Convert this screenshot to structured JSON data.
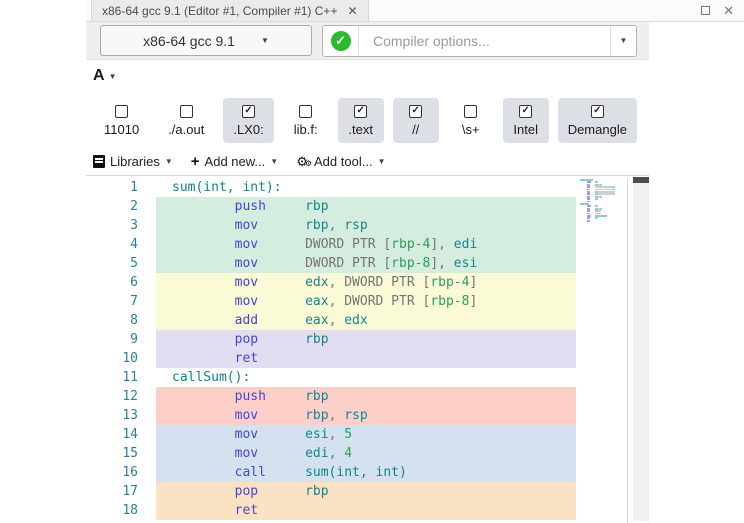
{
  "window": {
    "tab_title": "x86-64 gcc 9.1 (Editor #1, Compiler #1) C++",
    "tab_close": "✕",
    "close": "✕"
  },
  "toolbar": {
    "compiler_select_label": "x86-64 gcc 9.1",
    "status": "compile-success",
    "options_placeholder": "Compiler options...",
    "font_button_label": "A",
    "filters": [
      {
        "label": "11010",
        "checked": false
      },
      {
        "label": "./a.out",
        "checked": false
      },
      {
        "label": ".LX0:",
        "checked": true
      },
      {
        "label": "lib.f:",
        "checked": false
      },
      {
        "label": ".text",
        "checked": true
      },
      {
        "label": "//",
        "checked": true
      },
      {
        "label": "\\s+",
        "checked": false
      },
      {
        "label": "Intel",
        "checked": true
      },
      {
        "label": "Demangle",
        "checked": true
      }
    ],
    "actions": [
      {
        "icon": "book-icon",
        "label": "Libraries"
      },
      {
        "icon": "plus-icon",
        "label": "Add new..."
      },
      {
        "icon": "gears-icon",
        "label": "Add tool..."
      }
    ]
  },
  "editor": {
    "lines": [
      {
        "n": "1",
        "bg": "",
        "tokens": [
          {
            "t": "sum(int, int):",
            "c": "lab"
          }
        ]
      },
      {
        "n": "2",
        "bg": "green",
        "tokens": [
          {
            "t": "        ",
            "c": "pln"
          },
          {
            "t": "push",
            "c": "mne"
          },
          {
            "t": "     ",
            "c": "pln"
          },
          {
            "t": "rbp",
            "c": "reg"
          }
        ]
      },
      {
        "n": "3",
        "bg": "green",
        "tokens": [
          {
            "t": "        ",
            "c": "pln"
          },
          {
            "t": "mov",
            "c": "mne"
          },
          {
            "t": "      ",
            "c": "pln"
          },
          {
            "t": "rbp",
            "c": "reg"
          },
          {
            "t": ", ",
            "c": "pun"
          },
          {
            "t": "rsp",
            "c": "reg"
          }
        ]
      },
      {
        "n": "4",
        "bg": "green",
        "tokens": [
          {
            "t": "        ",
            "c": "pln"
          },
          {
            "t": "mov",
            "c": "mne"
          },
          {
            "t": "      ",
            "c": "pln"
          },
          {
            "t": "DWORD PTR [",
            "c": "pun"
          },
          {
            "t": "rbp",
            "c": "mem"
          },
          {
            "t": "-",
            "c": "pun"
          },
          {
            "t": "4",
            "c": "num"
          },
          {
            "t": "], ",
            "c": "pun"
          },
          {
            "t": "edi",
            "c": "reg"
          }
        ]
      },
      {
        "n": "5",
        "bg": "green",
        "tokens": [
          {
            "t": "        ",
            "c": "pln"
          },
          {
            "t": "mov",
            "c": "mne"
          },
          {
            "t": "      ",
            "c": "pln"
          },
          {
            "t": "DWORD PTR [",
            "c": "pun"
          },
          {
            "t": "rbp",
            "c": "mem"
          },
          {
            "t": "-",
            "c": "pun"
          },
          {
            "t": "8",
            "c": "num"
          },
          {
            "t": "], ",
            "c": "pun"
          },
          {
            "t": "esi",
            "c": "reg"
          }
        ]
      },
      {
        "n": "6",
        "bg": "yellow",
        "tokens": [
          {
            "t": "        ",
            "c": "pln"
          },
          {
            "t": "mov",
            "c": "mne"
          },
          {
            "t": "      ",
            "c": "pln"
          },
          {
            "t": "edx",
            "c": "reg"
          },
          {
            "t": ", ",
            "c": "pun"
          },
          {
            "t": "DWORD PTR [",
            "c": "pun"
          },
          {
            "t": "rbp",
            "c": "mem"
          },
          {
            "t": "-",
            "c": "pun"
          },
          {
            "t": "4",
            "c": "num"
          },
          {
            "t": "]",
            "c": "pun"
          }
        ]
      },
      {
        "n": "7",
        "bg": "yellow",
        "tokens": [
          {
            "t": "        ",
            "c": "pln"
          },
          {
            "t": "mov",
            "c": "mne"
          },
          {
            "t": "      ",
            "c": "pln"
          },
          {
            "t": "eax",
            "c": "reg"
          },
          {
            "t": ", ",
            "c": "pun"
          },
          {
            "t": "DWORD PTR [",
            "c": "pun"
          },
          {
            "t": "rbp",
            "c": "mem"
          },
          {
            "t": "-",
            "c": "pun"
          },
          {
            "t": "8",
            "c": "num"
          },
          {
            "t": "]",
            "c": "pun"
          }
        ]
      },
      {
        "n": "8",
        "bg": "yellow",
        "tokens": [
          {
            "t": "        ",
            "c": "pln"
          },
          {
            "t": "add",
            "c": "mne"
          },
          {
            "t": "      ",
            "c": "pln"
          },
          {
            "t": "eax",
            "c": "reg"
          },
          {
            "t": ", ",
            "c": "pun"
          },
          {
            "t": "edx",
            "c": "reg"
          }
        ]
      },
      {
        "n": "9",
        "bg": "purple",
        "tokens": [
          {
            "t": "        ",
            "c": "pln"
          },
          {
            "t": "pop",
            "c": "mne"
          },
          {
            "t": "      ",
            "c": "pln"
          },
          {
            "t": "rbp",
            "c": "reg"
          }
        ]
      },
      {
        "n": "10",
        "bg": "purple",
        "tokens": [
          {
            "t": "        ",
            "c": "pln"
          },
          {
            "t": "ret",
            "c": "mne"
          }
        ]
      },
      {
        "n": "11",
        "bg": "",
        "tokens": [
          {
            "t": "callSum():",
            "c": "lab"
          }
        ]
      },
      {
        "n": "12",
        "bg": "red",
        "tokens": [
          {
            "t": "        ",
            "c": "pln"
          },
          {
            "t": "push",
            "c": "mne"
          },
          {
            "t": "     ",
            "c": "pln"
          },
          {
            "t": "rbp",
            "c": "reg"
          }
        ]
      },
      {
        "n": "13",
        "bg": "red",
        "tokens": [
          {
            "t": "        ",
            "c": "pln"
          },
          {
            "t": "mov",
            "c": "mne"
          },
          {
            "t": "      ",
            "c": "pln"
          },
          {
            "t": "rbp",
            "c": "reg"
          },
          {
            "t": ", ",
            "c": "pun"
          },
          {
            "t": "rsp",
            "c": "reg"
          }
        ]
      },
      {
        "n": "14",
        "bg": "blue",
        "tokens": [
          {
            "t": "        ",
            "c": "pln"
          },
          {
            "t": "mov",
            "c": "mne"
          },
          {
            "t": "      ",
            "c": "pln"
          },
          {
            "t": "esi",
            "c": "reg"
          },
          {
            "t": ", ",
            "c": "pun"
          },
          {
            "t": "5",
            "c": "num"
          }
        ]
      },
      {
        "n": "15",
        "bg": "blue",
        "tokens": [
          {
            "t": "        ",
            "c": "pln"
          },
          {
            "t": "mov",
            "c": "mne"
          },
          {
            "t": "      ",
            "c": "pln"
          },
          {
            "t": "edi",
            "c": "reg"
          },
          {
            "t": ", ",
            "c": "pun"
          },
          {
            "t": "4",
            "c": "num"
          }
        ]
      },
      {
        "n": "16",
        "bg": "blue",
        "tokens": [
          {
            "t": "        ",
            "c": "pln"
          },
          {
            "t": "call",
            "c": "mne"
          },
          {
            "t": "     ",
            "c": "pln"
          },
          {
            "t": "sum(int, int)",
            "c": "lab"
          }
        ]
      },
      {
        "n": "17",
        "bg": "orange",
        "tokens": [
          {
            "t": "        ",
            "c": "pln"
          },
          {
            "t": "pop",
            "c": "mne"
          },
          {
            "t": "      ",
            "c": "pln"
          },
          {
            "t": "rbp",
            "c": "reg"
          }
        ]
      },
      {
        "n": "18",
        "bg": "orange",
        "tokens": [
          {
            "t": "        ",
            "c": "pln"
          },
          {
            "t": "ret",
            "c": "mne"
          }
        ]
      }
    ]
  },
  "colors": {
    "accent_green": "#2db92d",
    "line_green": "#d5eddf",
    "line_yellow": "#fafad6",
    "line_purple": "#e2ddf0",
    "line_red": "#fcd0c9",
    "line_blue": "#d3e2ee",
    "line_orange": "#fbe2c2",
    "tok_mnemonic": "#4444d6",
    "tok_register": "#16848c",
    "tok_number": "#2a9d5c",
    "tok_memreg": "#2a9d5c",
    "tok_punct": "#757575",
    "tok_label": "#12828a",
    "line_number": "#2c7f99",
    "filter_active_bg": "#dce0e6"
  }
}
